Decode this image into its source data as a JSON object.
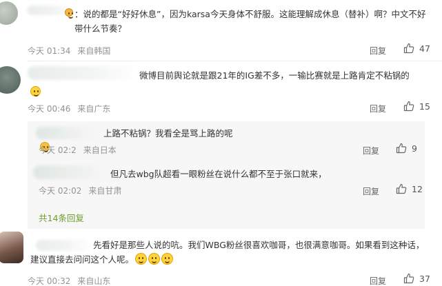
{
  "comments": [
    {
      "text": "：说的都是“好好休息”，因为karsa今天身体不舒服。这能理解成休息（替补）啊？中文不好带什么节奏？",
      "time": "今天 01:34",
      "location": "来自韩国",
      "reply_label": "回复",
      "likes": "47"
    },
    {
      "text": "微博目前舆论就是跟21年的IG差不多，一输比赛就是上路肯定不粘锅的",
      "time": "今天 00:46",
      "location": "来自广东",
      "reply_label": "回复",
      "likes": "15"
    },
    {
      "text": "先看好是那些人说的吭。我们WBG粉丝很喜欢咖哥，也很满意咖哥。如果看到这种话，建议直接去问问这个人呢。",
      "time": "今天 00:32",
      "location": "来自山东",
      "reply_label": "回复",
      "likes": "37"
    }
  ],
  "replies": [
    {
      "text": "上路不粘锅？我看全是骂上路的呢",
      "time": "今天 02:2",
      "location": "来自日本",
      "reply_label": "回复",
      "likes": "9"
    },
    {
      "text": "但凡去wbg队超看一眼粉丝在说什么都不至于张口就来，",
      "time": "今天 02:02",
      "location": "来自甘肃",
      "reply_label": "回复",
      "likes": "12"
    }
  ],
  "more_replies": "共14条回复",
  "icons": {
    "like": "thumbs-up-icon",
    "emoji": "grinning-face-emoji",
    "reply_tail": "chevron-right-icon"
  },
  "colors": {
    "link": "#6d9f2e",
    "meta": "#939393",
    "text": "#333333",
    "sub_bg": "#f7f7f7"
  }
}
